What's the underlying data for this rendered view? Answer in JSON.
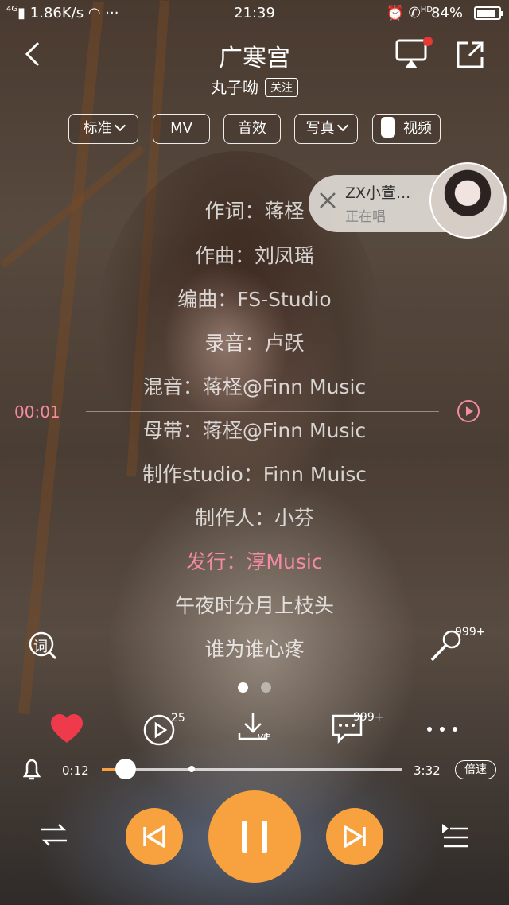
{
  "status_bar": {
    "network": "4G",
    "speed": "1.86K/s",
    "time": "21:39",
    "hd_label": "HD",
    "battery": "84%",
    "battery_level": 0.84
  },
  "header": {
    "title": "广寒宫",
    "artist": "丸子呦",
    "follow_label": "关注"
  },
  "chips": {
    "quality": "标准",
    "mv": "MV",
    "effect": "音效",
    "photo": "写真",
    "video": "视频"
  },
  "singing_popup": {
    "name": "ZX小萱...",
    "status": "正在唱"
  },
  "lyrics": [
    {
      "text": "作词：蒋柽",
      "active": false
    },
    {
      "text": "作曲：刘凤瑶",
      "active": false
    },
    {
      "text": "编曲：FS-Studio",
      "active": false
    },
    {
      "text": "录音：卢跃",
      "active": false
    },
    {
      "text": "混音：蒋柽@Finn Music",
      "active": false
    },
    {
      "text": "母带：蒋柽@Finn Music",
      "active": false
    },
    {
      "text": "制作studio：Finn Muisc",
      "active": false
    },
    {
      "text": "制作人：小芬",
      "active": false
    },
    {
      "text": "发行：淳Music",
      "active": true
    },
    {
      "text": "午夜时分月上枝头",
      "active": false
    },
    {
      "text": "谁为谁心疼",
      "active": false
    }
  ],
  "timeline": {
    "time": "00:01"
  },
  "lyric_tools": {
    "lyric_icon_char": "词",
    "mic_badge": "999+"
  },
  "actions": {
    "timer_badge": "25",
    "download_tag": "VIP",
    "comment_badge": "999+"
  },
  "progress": {
    "current": "0:12",
    "total": "3:32",
    "played_fraction": 0.057,
    "buffered_fraction": 0.3,
    "speed_label": "倍速"
  },
  "colors": {
    "accent": "#f7a23f",
    "active_lyric": "#f48aa3",
    "like": "#ee3a4a"
  }
}
